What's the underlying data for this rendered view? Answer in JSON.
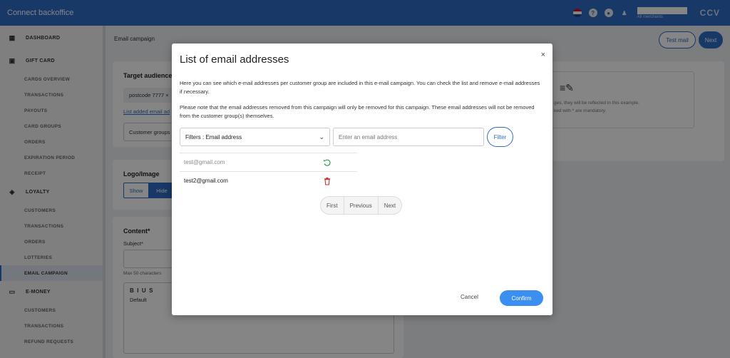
{
  "app": {
    "title": "Connect backoffice",
    "brand": "CCV",
    "merchant_sub": "All merchants"
  },
  "sidebar": {
    "sections": [
      {
        "label": "DASHBOARD",
        "icon": "grid-icon",
        "items": []
      },
      {
        "label": "GIFT CARD",
        "icon": "gift-icon",
        "items": [
          "CARDS OVERVIEW",
          "TRANSACTIONS",
          "PAYOUTS",
          "CARD GROUPS",
          "ORDERS",
          "EXPIRATION PERIOD",
          "RECEIPT"
        ]
      },
      {
        "label": "LOYALTY",
        "icon": "tag-icon",
        "items": [
          "CUSTOMERS",
          "TRANSACTIONS",
          "ORDERS",
          "LOTTERIES",
          "EMAIL CAMPAIGN"
        ]
      },
      {
        "label": "E-MONEY",
        "icon": "card-icon",
        "items": [
          "CUSTOMERS",
          "TRANSACTIONS",
          "REFUND REQUESTS"
        ]
      }
    ],
    "active_item": "EMAIL CAMPAIGN"
  },
  "background": {
    "breadcrumb": "Email campaign",
    "test_mail_label": "Test mail",
    "next_label": "Next",
    "target_audience_title": "Target audience*",
    "postcode_chip": "postcode 7777 ×",
    "list_link": "List added email ad",
    "customer_groups": "Customer groups",
    "logo_title": "Logo/Image",
    "show_label": "Show",
    "hide_label": "Hide",
    "content_title": "Content*",
    "subject_label": "Subject*",
    "max_chars": "Max 50 characters",
    "editor_default": "Default",
    "preview_line1": "ges, they will be reflected in this example.",
    "preview_line2": "ked with * are mandatory."
  },
  "modal": {
    "title": "List of email addresses",
    "close_label": "×",
    "paragraph1": "Here you can see which e-mail addresses per customer group are included in this e-mail campaign. You can check the list and remove e-mail addresses if necessary.",
    "paragraph2": "Please note that the email addresses removed from this campaign will only be removed for this campaign. These email addresses will not be removed from the customer group(s) themselves.",
    "filter_select_value": "Filters : Email address",
    "email_placeholder": "Enter an email address",
    "filter_button": "Filter",
    "rows": [
      {
        "email": "test@gmail.com",
        "removed": true,
        "action_icon": "undo-icon",
        "action_color": "#2e9e4f"
      },
      {
        "email": "test2@gmail.com",
        "removed": false,
        "action_icon": "trash-icon",
        "action_color": "#d62b2b"
      }
    ],
    "pager": {
      "first": "First",
      "previous": "Previous",
      "next": "Next"
    },
    "cancel_label": "Cancel",
    "confirm_label": "Confirm"
  },
  "colors": {
    "primary": "#2f6bc7",
    "confirm": "#3a8ff0"
  }
}
